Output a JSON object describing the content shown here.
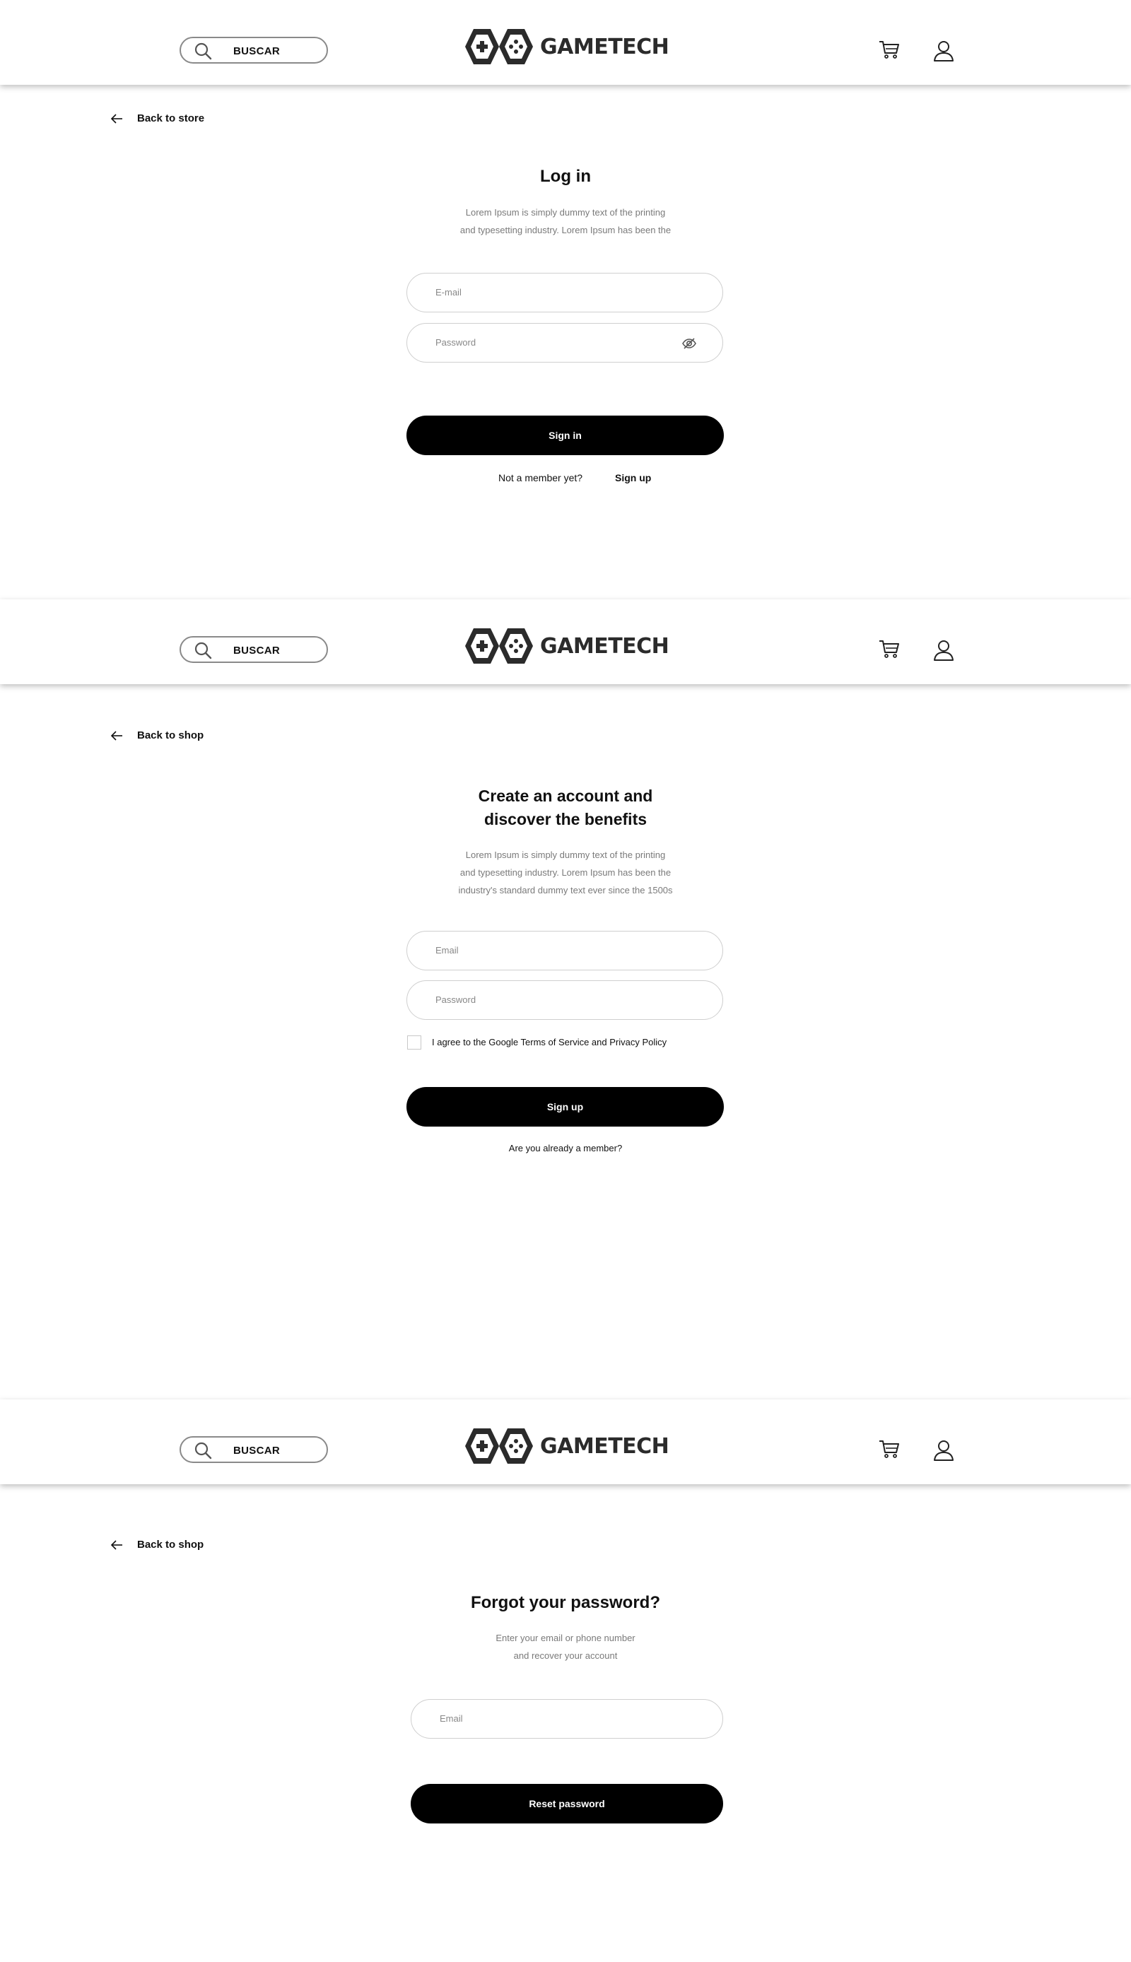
{
  "brand": {
    "name": "GAMETECH"
  },
  "header": {
    "search_label": "BUSCAR"
  },
  "login": {
    "back_label": "Back to store",
    "title": "Log in",
    "subtitle_lines": [
      "Lorem Ipsum is simply dummy text of the printing",
      "and typesetting industry. Lorem Ipsum has been the"
    ],
    "email_placeholder": "E-mail",
    "password_placeholder": "Password",
    "submit_label": "Sign in",
    "not_member_text": "Not a member yet?",
    "signup_link": "Sign up"
  },
  "signup": {
    "back_label": "Back to shop",
    "title_lines": [
      "Create an account and",
      "discover the benefits"
    ],
    "subtitle_lines": [
      "Lorem Ipsum is simply dummy text of the printing",
      "and typesetting industry. Lorem Ipsum has been the",
      "industry's standard dummy text ever since the 1500s"
    ],
    "email_placeholder": "Email",
    "password_placeholder": "Password",
    "terms_label": "I agree to the Google Terms of Service and Privacy Policy",
    "terms_checked": false,
    "submit_label": "Sign up",
    "member_link": "Are you already a member?"
  },
  "forgot": {
    "back_label": "Back to shop",
    "title": "Forgot your password?",
    "subtitle_lines": [
      "Enter your email or phone number",
      "and recover your account"
    ],
    "email_placeholder": "Email",
    "submit_label": "Reset password"
  }
}
